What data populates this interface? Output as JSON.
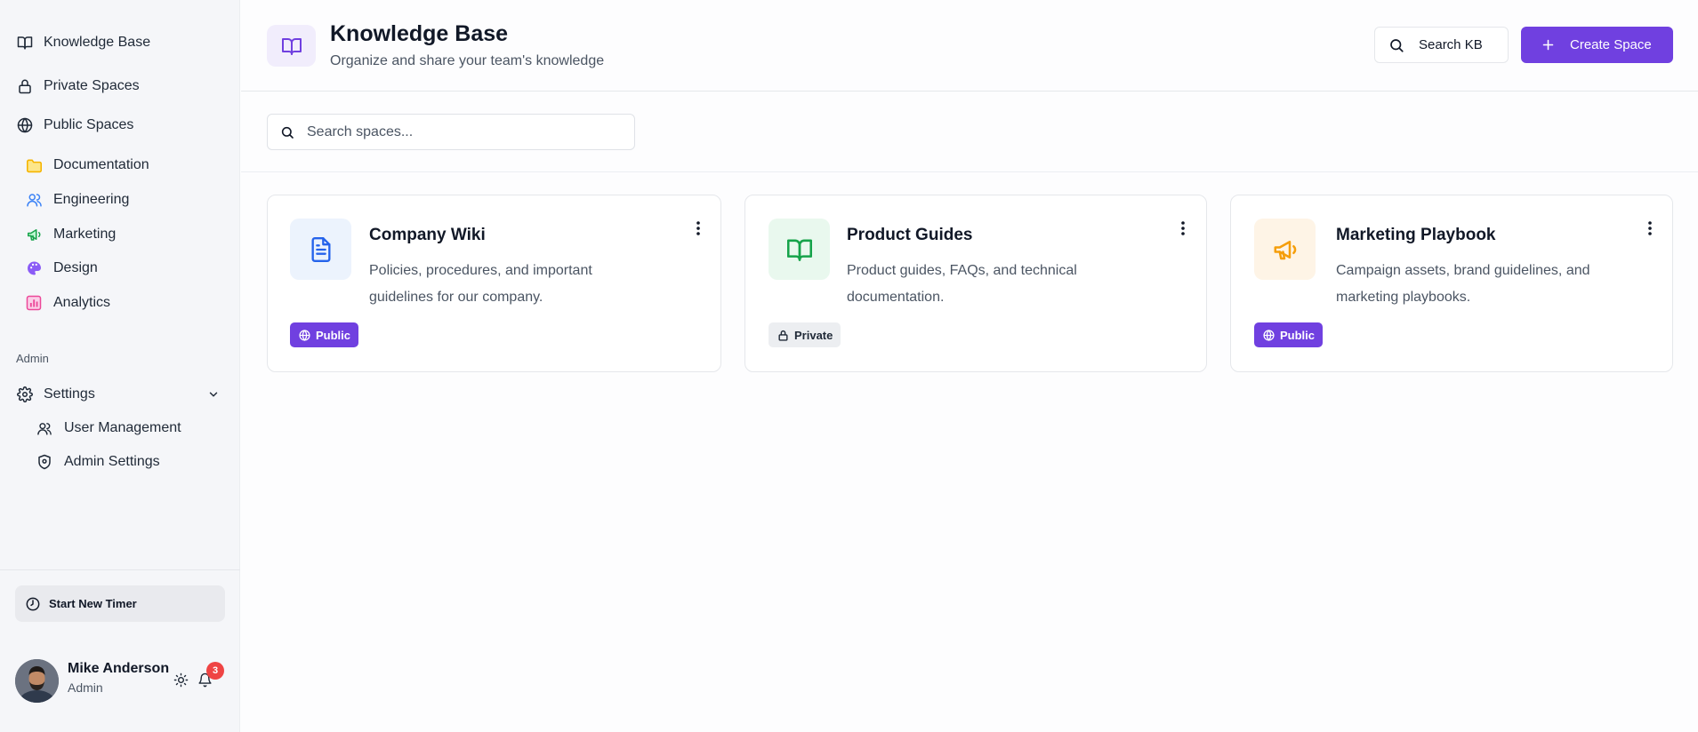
{
  "sidebar": {
    "items": [
      {
        "label": "Knowledge Base",
        "icon": "book-icon"
      },
      {
        "label": "Private Spaces",
        "icon": "lock-icon"
      },
      {
        "label": "Public Spaces",
        "icon": "globe-icon"
      }
    ],
    "spaces": [
      {
        "label": "Documentation",
        "icon": "folder-icon",
        "color": "#f5b400"
      },
      {
        "label": "Engineering",
        "icon": "users-icon",
        "color": "#3b82f6"
      },
      {
        "label": "Marketing",
        "icon": "megaphone-icon",
        "color": "#16a34a"
      },
      {
        "label": "Design",
        "icon": "palette-icon",
        "color": "#8b5cf6"
      },
      {
        "label": "Analytics",
        "icon": "bar-chart-icon",
        "color": "#ec4899"
      }
    ],
    "section_admin": "Admin",
    "settings": {
      "label": "Settings",
      "icon": "gear-icon"
    },
    "admin_items": [
      {
        "label": "User Management",
        "icon": "users-icon"
      },
      {
        "label": "Admin Settings",
        "icon": "shield-icon"
      }
    ],
    "timer_label": "Start New Timer",
    "user": {
      "name": "Mike Anderson",
      "role": "Admin",
      "notifications": "3"
    }
  },
  "header": {
    "title": "Knowledge Base",
    "subtitle": "Organize and share your team's knowledge",
    "search_label": "Search KB",
    "create_label": "Create Space"
  },
  "search": {
    "placeholder": "Search spaces..."
  },
  "cards": [
    {
      "title": "Company Wiki",
      "description_line1": "Policies, procedures, and important",
      "description_line2": "guidelines for our company.",
      "badge": "Public",
      "icon": "document-icon",
      "accent": "#2563eb",
      "icon_bg": "#ecf3fd"
    },
    {
      "title": "Product Guides",
      "description_line1": "Product guides, FAQs, and technical",
      "description_line2": "documentation.",
      "badge": "Private",
      "icon": "book-open-icon",
      "accent": "#16a34a",
      "icon_bg": "#e9f8ee"
    },
    {
      "title": "Marketing Playbook",
      "description_line1": "Campaign assets, brand guidelines, and",
      "description_line2": "marketing playbooks.",
      "badge": "Public",
      "icon": "megaphone-icon",
      "accent": "#f59e0b",
      "icon_bg": "#fef4e6"
    }
  ],
  "colors": {
    "brand": "#7040e0",
    "danger": "#ef4444"
  }
}
